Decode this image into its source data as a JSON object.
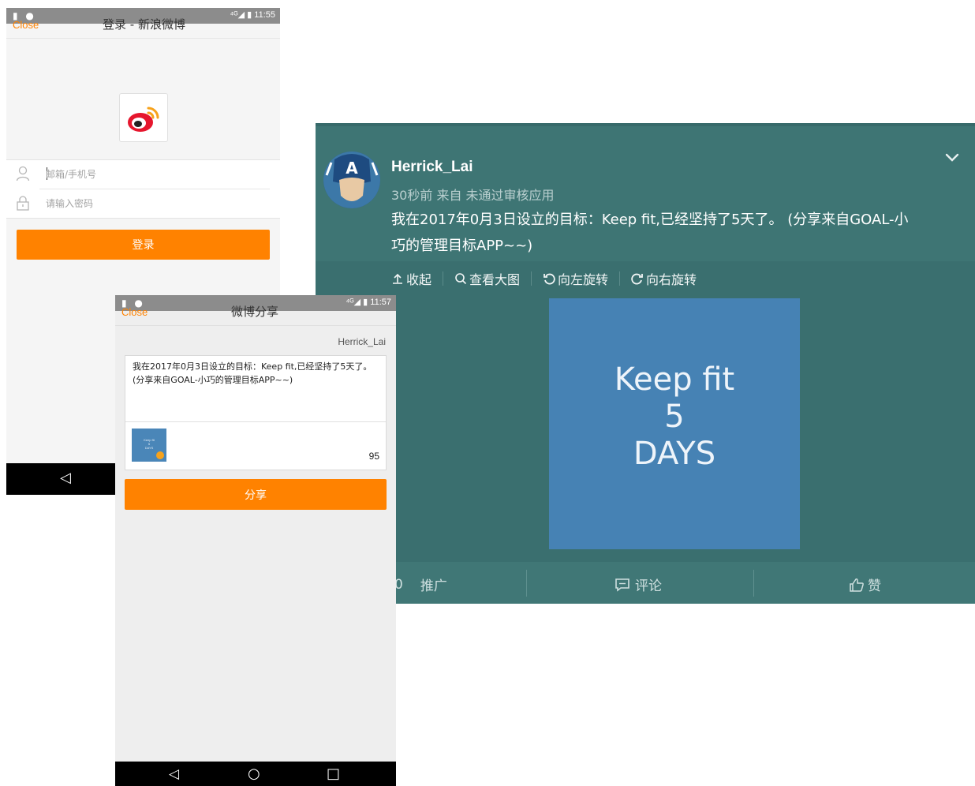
{
  "login_screen": {
    "statusbar": {
      "icons": "▮ ●",
      "signal": "⁴ᴳ◢",
      "time": "11:55"
    },
    "close_label": "Close",
    "title": "登录 - 新浪微博",
    "email_placeholder": "邮箱/手机号",
    "password_placeholder": "请输入密码",
    "login_button": "登录",
    "nav_back": "◁"
  },
  "share_screen": {
    "statusbar": {
      "icons": "▮ ●",
      "signal": "⁴ᴳ◢",
      "time": "11:57"
    },
    "close_label": "Close",
    "title": "微博分享",
    "username": "Herrick_Lai",
    "share_text": "我在2017年0月3日设立的目标：Keep fit,已经坚持了5天了。 (分享来自GOAL-小巧的管理目标APP~~)",
    "thumbnail_text": [
      "Keep fit",
      "5",
      "DAYS"
    ],
    "char_count": "95",
    "share_button": "分享",
    "nav": [
      "◁",
      "○",
      "□"
    ]
  },
  "weibo_post": {
    "username": "Herrick_Lai",
    "meta": "30秒前 来自 未通过审核应用",
    "text_line1": "我在2017年0月3日设立的目标：Keep fit,已经坚持了5天了。 (分享来自GOAL-小",
    "text_line2": "巧的管理目标APP~~)",
    "toolbar": {
      "collapse": "收起",
      "view_large": "查看大图",
      "rotate_left": "向左旋转",
      "rotate_right": "向右旋转"
    },
    "image_text": [
      "Keep fit",
      "5",
      "DAYS"
    ],
    "footer": {
      "promote_count": "0",
      "promote": "推广",
      "comment": "评论",
      "like": "赞"
    },
    "colors": {
      "panel": "#3a6f6f",
      "image_bg": "#4682b4",
      "accent_orange": "#ff8200"
    }
  }
}
